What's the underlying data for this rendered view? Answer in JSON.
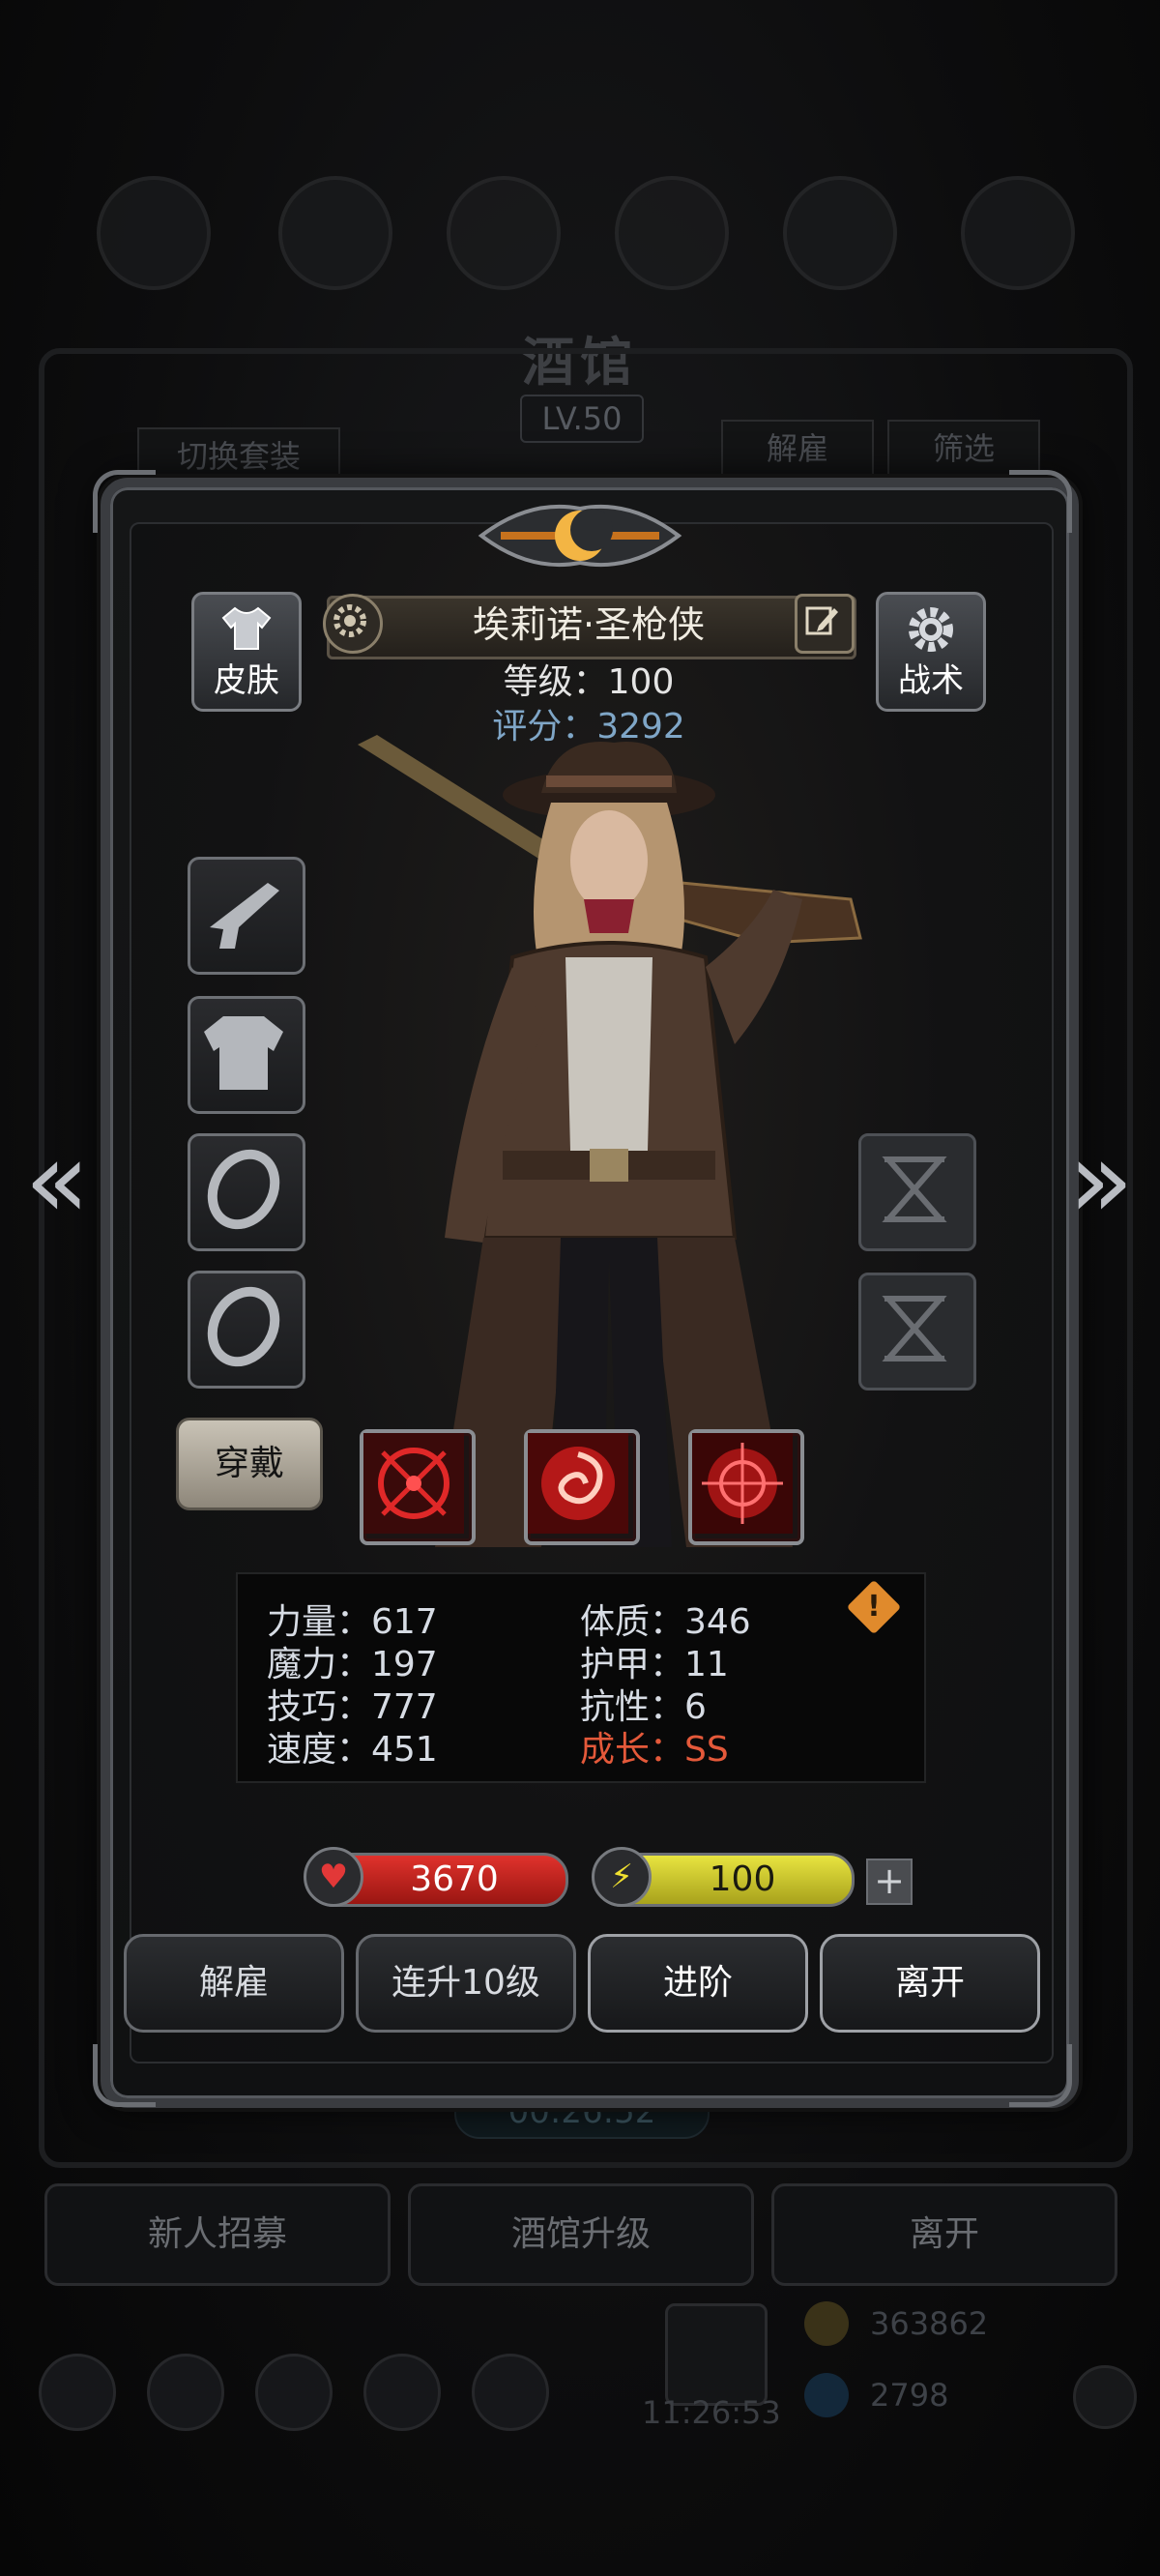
{
  "background": {
    "title": "酒馆",
    "level_badge": "LV.50",
    "switch_outfit": "切换套装",
    "dismiss": "解雇",
    "filter": "筛选",
    "timer": "00:26:52",
    "bottom_buttons": [
      "新人招募",
      "酒馆升级",
      "离开"
    ],
    "gold": "363862",
    "gems": "2798",
    "clock": "11:26:53"
  },
  "hero": {
    "name": "埃莉诺·圣枪侠",
    "level_label": "等级：100",
    "score_label": "评分：3292",
    "skin_label": "皮肤",
    "tactics_label": "战术",
    "wear_label": "穿戴"
  },
  "stats": {
    "strength": "力量：617",
    "magic": "魔力：197",
    "skill": "技巧：777",
    "speed": "速度：451",
    "constitution": "体质：346",
    "armor": "护甲：11",
    "resistance": "抗性：6",
    "growth": "成长：SS"
  },
  "bars": {
    "hp": "3670",
    "energy": "100",
    "plus": "+"
  },
  "actions": {
    "dismiss": "解雇",
    "level_up_10": "连升10级",
    "advance": "进阶",
    "leave": "离开"
  },
  "nav": {
    "left_arrow": "«",
    "right_arrow": "»"
  },
  "colors": {
    "score": "#7fa6c7",
    "growth": "#e4593a",
    "hp_bar": "#c0231e",
    "energy_bar": "#c9c62a",
    "warning": "#e08a2c"
  },
  "icons": [
    "pistol-slot-icon",
    "armor-slot-icon",
    "ring-slot-icon",
    "ring-slot-icon",
    "hourglass-slot-icon",
    "crosshair-skill-icon",
    "vortex-skill-icon",
    "target-skill-icon",
    "heart-icon",
    "lightning-icon",
    "gear-icon",
    "edit-icon",
    "shirt-icon"
  ]
}
